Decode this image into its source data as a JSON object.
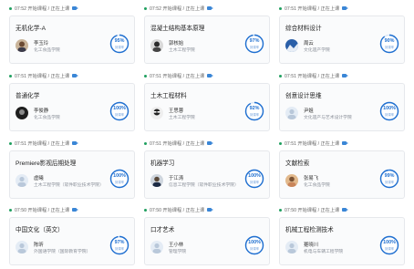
{
  "courses": [
    {
      "time": "07:52 开始课程 / 正在上课",
      "title": "无机化学-A",
      "teacher": "李玉玲",
      "college": "化工食品学院",
      "percent": "95%",
      "percent_value": 95,
      "label": "到课率",
      "avatar": "avatar-photo"
    },
    {
      "time": "07:52 开始课程 / 正在上课",
      "title": "混凝土结构基本原理",
      "teacher": "郭核始",
      "college": "土木工程学院",
      "percent": "97%",
      "percent_value": 97,
      "label": "到课率",
      "avatar": "avatar-person"
    },
    {
      "time": "07:51 开始课程 / 正在上课",
      "title": "综合材料设计",
      "teacher": "周云",
      "college": "文化遗产学院",
      "percent": "90%",
      "percent_value": 90,
      "label": "到课率",
      "avatar": "avatar-mountain"
    },
    {
      "time": "07:51 开始课程 / 正在上课",
      "title": "普通化学",
      "teacher": "李俊静",
      "college": "化工食品学院",
      "percent": "100%",
      "percent_value": 100,
      "label": "到课率",
      "avatar": "avatar-dark"
    },
    {
      "time": "07:51 开始课程 / 正在上课",
      "title": "土木工程材料",
      "teacher": "王思蓉",
      "college": "土木工程学院",
      "percent": "92%",
      "percent_value": 92,
      "label": "到课率",
      "avatar": "avatar-glasses"
    },
    {
      "time": "07:51 开始课程 / 正在上课",
      "title": "创意设计思维",
      "teacher": "尹姐",
      "college": "文化遗产与艺术设计学院",
      "percent": "100%",
      "percent_value": 100,
      "label": "到课率",
      "avatar": "avatar-default"
    },
    {
      "time": "07:51 开始课程 / 正在上课",
      "title": "Premiere影视后期处理",
      "teacher": "虚曦",
      "college": "土木工程学院（软件职业技术学院）",
      "percent": "100%",
      "percent_value": 100,
      "label": "到课率",
      "avatar": "avatar-default"
    },
    {
      "time": "07:51 开始课程 / 正在上课",
      "title": "机器学习",
      "teacher": "于江涛",
      "college": "信息工程学院（软件职业技术学院）",
      "percent": "100%",
      "percent_value": 100,
      "label": "到课率",
      "avatar": "avatar-suit"
    },
    {
      "time": "07:51 开始课程 / 正在上课",
      "title": "文献检索",
      "teacher": "张易飞",
      "college": "化工食品学院",
      "percent": "99%",
      "percent_value": 99,
      "label": "到课率",
      "avatar": "avatar-warm"
    },
    {
      "time": "07:50 开始课程 / 正在上课",
      "title": "中国文化（英文）",
      "teacher": "陈昕",
      "college": "外国语学院（国际教育学院）",
      "percent": "97%",
      "percent_value": 97,
      "label": "到课率",
      "avatar": "avatar-default"
    },
    {
      "time": "07:50 开始课程 / 正在上课",
      "title": "口才艺术",
      "teacher": "王小林",
      "college": "管理学院",
      "percent": "100%",
      "percent_value": 100,
      "label": "到课率",
      "avatar": "avatar-default"
    },
    {
      "time": "07:50 开始课程 / 正在上课",
      "title": "机械工程检测技术",
      "teacher": "蹇晓川",
      "college": "机电与车辆工程学院",
      "percent": "100%",
      "percent_value": 100,
      "label": "到课率",
      "avatar": "avatar-default"
    }
  ],
  "colors": {
    "accent": "#1f6fd0",
    "live_dot": "#20a060",
    "ring_track": "#dbe8f8"
  }
}
